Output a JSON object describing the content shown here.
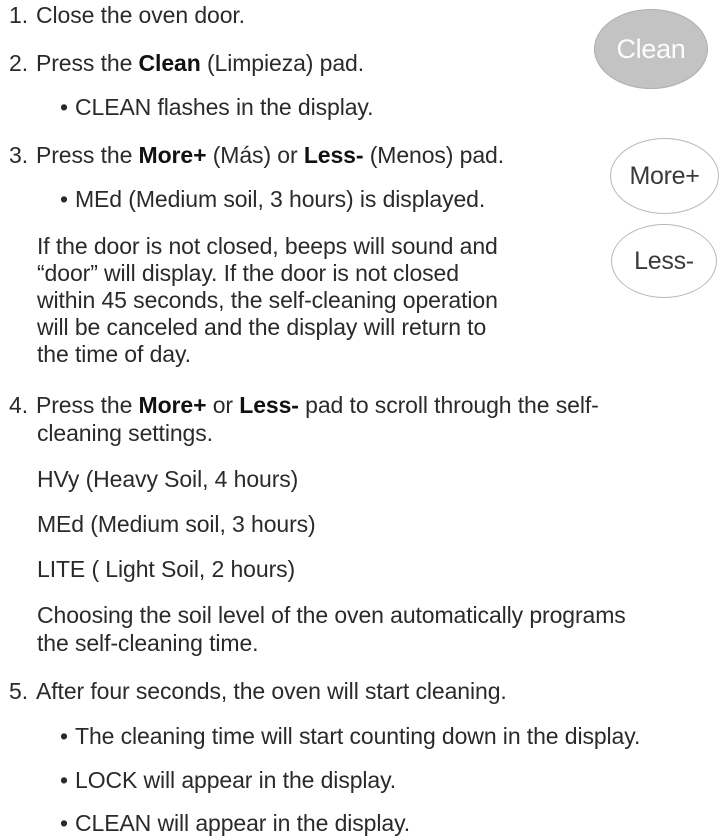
{
  "steps": {
    "s1": {
      "num": "1.",
      "text": "Close the oven door."
    },
    "s2": {
      "num": "2.",
      "pre": "Press the ",
      "bold": "Clean",
      "post": " (Limpieza) pad.",
      "bullet": "CLEAN flashes in the display."
    },
    "s3": {
      "num": "3.",
      "pre": "Press the ",
      "bold1": "More+",
      "mid1": " (Más) or ",
      "bold2": "Less-",
      "post": " (Menos) pad.",
      "bullet": "MEd (Medium soil, 3 hours) is displayed.",
      "note": [
        "If the door is not closed, beeps will sound and",
        "“door” will display.  If the door is not closed",
        "within 45 seconds, the self-cleaning operation",
        "will be canceled and the display will return to",
        "the time of day."
      ]
    },
    "s4": {
      "num": "4.",
      "pre": "Press the ",
      "bold1": "More+",
      "mid1": " or ",
      "bold2": "Less-",
      "post": " pad to scroll through the self-",
      "cont": "cleaning settings.",
      "settings": [
        "HVy (Heavy Soil, 4 hours)",
        "MEd (Medium soil, 3 hours)",
        "LITE ( Light Soil, 2 hours)"
      ],
      "note": [
        "Choosing the soil level of the oven automatically programs",
        "the self-cleaning time."
      ]
    },
    "s5": {
      "num": "5.",
      "text": "After four seconds, the oven will start cleaning.",
      "bullets": [
        "The cleaning time will start counting down in the display.",
        "LOCK will appear in the display.",
        "CLEAN will appear in the display."
      ]
    }
  },
  "pads": {
    "clean": "Clean",
    "more": "More+",
    "less": "Less-"
  },
  "bullet_glyph": "•"
}
